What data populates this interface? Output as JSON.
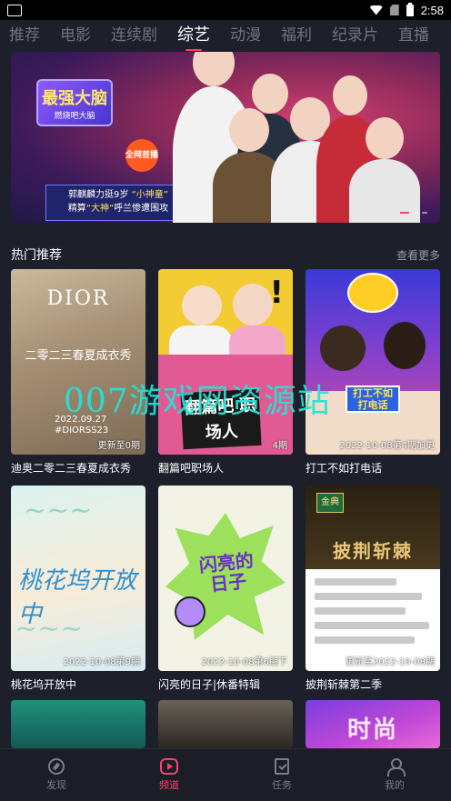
{
  "status_bar": {
    "time": "2:58",
    "icons": [
      "wifi-icon",
      "no-sim-icon",
      "battery-icon"
    ]
  },
  "tabs": [
    {
      "label": "推荐",
      "active": false
    },
    {
      "label": "电影",
      "active": false
    },
    {
      "label": "连续剧",
      "active": false
    },
    {
      "label": "综艺",
      "active": true
    },
    {
      "label": "动漫",
      "active": false
    },
    {
      "label": "福利",
      "active": false
    },
    {
      "label": "纪录片",
      "active": false
    },
    {
      "label": "直播",
      "active": false
    }
  ],
  "banner": {
    "logo_line1": "最强大脑",
    "logo_line2": "燃烧吧大脑",
    "badge": "全网首播",
    "caption_line1_a": "郭麒麟力挺9岁 ",
    "caption_line1_b": "“小神童”",
    "caption_line2_a": "精算",
    "caption_line2_b": "“大神”",
    "caption_line2_c": "呼兰惨遭围攻"
  },
  "section": {
    "title": "热门推荐",
    "more": "查看更多"
  },
  "cards": [
    {
      "title": "迪奥二零二三春夏成衣秀",
      "tag": "更新至0期",
      "brand": "DIOR",
      "subtitle": "二零二三春夏成衣秀",
      "date": "2022.09.27",
      "hashtag": "#DIORSS23"
    },
    {
      "title": "翻篇吧职场人",
      "tag": "4期",
      "sign": "翻篇吧 职场人"
    },
    {
      "title": "打工不如打电话",
      "tag": "2022-10-08第4期加更",
      "sign": "打工不如 打电话"
    },
    {
      "title": "桃花坞开放中",
      "tag": "2022-10-08第9期"
    },
    {
      "title": "闪亮的日子|休番特辑",
      "tag": "2022-10-08第6期下",
      "art": "闪亮的 日子"
    },
    {
      "title": "披荆斩棘第二季",
      "tag": "更新至2022-10-08期",
      "art": "披荆斩棘",
      "logo": "金典"
    }
  ],
  "more_row": {
    "art3": "时尚"
  },
  "watermark": "007游戏网资源站",
  "bottom_nav": [
    {
      "label": "发现",
      "icon": "compass-icon",
      "active": false
    },
    {
      "label": "频道",
      "icon": "play-icon",
      "active": true
    },
    {
      "label": "任务",
      "icon": "task-icon",
      "active": false
    },
    {
      "label": "我的",
      "icon": "user-icon",
      "active": false
    }
  ],
  "colors": {
    "background": "#1d1f2b",
    "accent": "#ff3f6c",
    "inactive_text": "#6f7282"
  }
}
